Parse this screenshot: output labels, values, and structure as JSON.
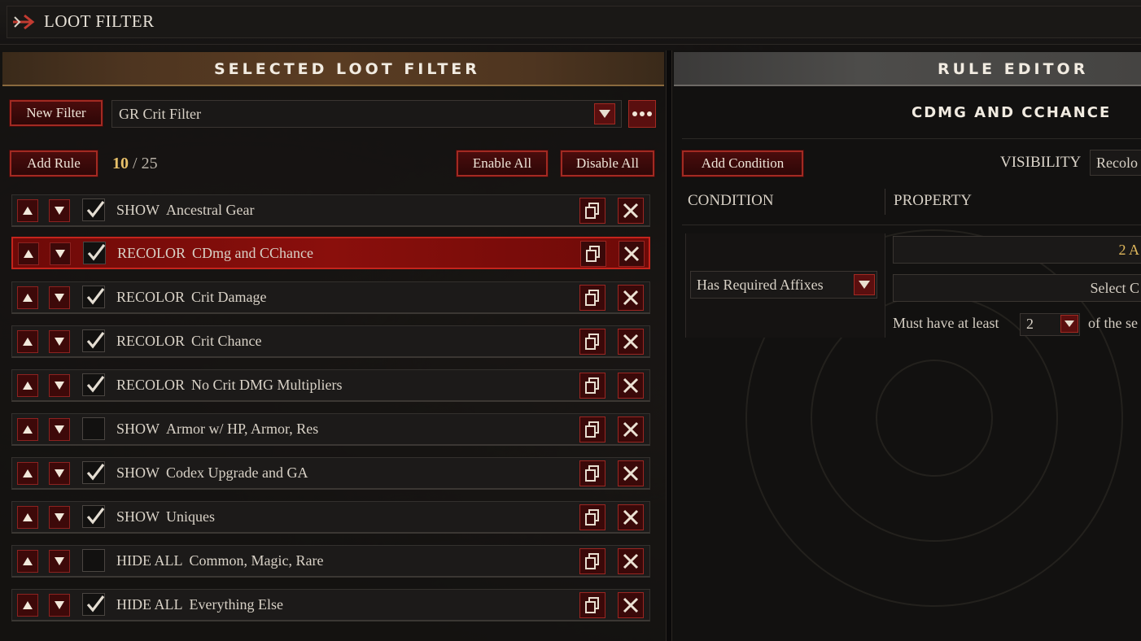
{
  "app": {
    "title": "LOOT FILTER"
  },
  "left_panel": {
    "header": "SELECTED LOOT FILTER",
    "new_filter_label": "New Filter",
    "selected_filter": "GR Crit Filter",
    "add_rule_label": "Add Rule",
    "rule_count": "10",
    "rule_max": "25",
    "count_sep": "/",
    "enable_all_label": "Enable All",
    "disable_all_label": "Disable All"
  },
  "rules": [
    {
      "action": "SHOW",
      "name": "Ancestral Gear",
      "enabled": true,
      "selected": false
    },
    {
      "action": "RECOLOR",
      "name": "CDmg and CChance",
      "enabled": true,
      "selected": true
    },
    {
      "action": "RECOLOR",
      "name": "Crit Damage",
      "enabled": true,
      "selected": false
    },
    {
      "action": "RECOLOR",
      "name": "Crit Chance",
      "enabled": true,
      "selected": false
    },
    {
      "action": "RECOLOR",
      "name": "No Crit DMG Multipliers",
      "enabled": true,
      "selected": false
    },
    {
      "action": "SHOW",
      "name": "Armor w/ HP, Armor, Res",
      "enabled": false,
      "selected": false
    },
    {
      "action": "SHOW",
      "name": "Codex Upgrade and GA",
      "enabled": true,
      "selected": false
    },
    {
      "action": "SHOW",
      "name": "Uniques",
      "enabled": true,
      "selected": false
    },
    {
      "action": "HIDE ALL",
      "name": "Common, Magic, Rare",
      "enabled": false,
      "selected": false
    },
    {
      "action": "HIDE ALL",
      "name": "Everything Else",
      "enabled": true,
      "selected": false
    }
  ],
  "right_panel": {
    "header": "RULE EDITOR",
    "rule_name": "CDMG AND CCHANCE",
    "add_condition_label": "Add Condition",
    "visibility_label": "VISIBILITY",
    "visibility_value": "Recolo",
    "condition_col": "CONDITION",
    "property_col": "PROPERTY",
    "condition_value": "Has Required Affixes",
    "property_1": "2 A",
    "property_2": "Select C",
    "must_have_text": "Must have at least",
    "must_have_value": "2",
    "of_the_text": "of the se"
  },
  "colors": {
    "accent_red": "#a22a22",
    "selected_row": "#8a0f0c",
    "count_gold": "#e7c06a",
    "header_gold": "#8a6a3e"
  },
  "icons": {
    "back": "arrow-right-icon",
    "up": "triangle-up-icon",
    "down": "triangle-down-icon",
    "check": "checkmark-icon",
    "copy": "copy-icon",
    "delete": "x-icon",
    "more": "ellipsis-icon",
    "dropdown": "chevron-down-icon"
  }
}
